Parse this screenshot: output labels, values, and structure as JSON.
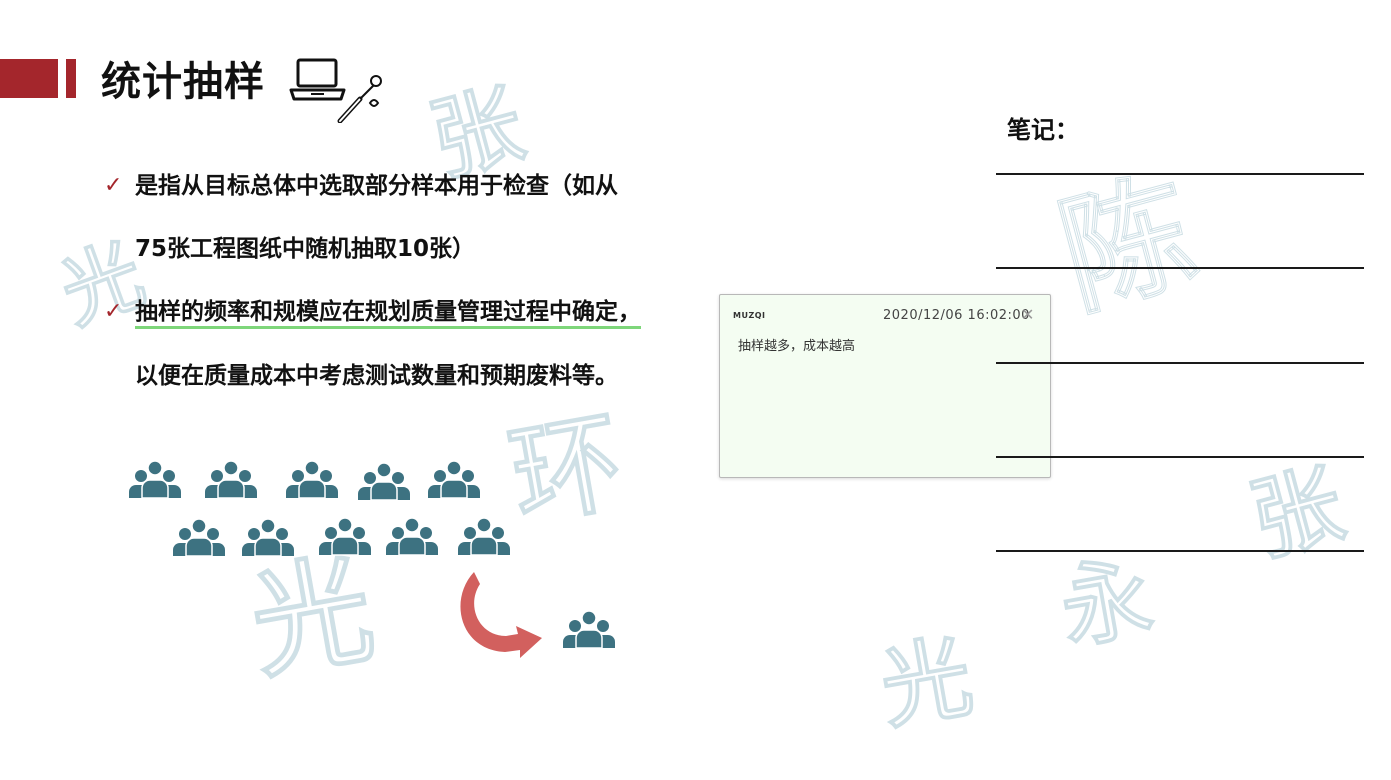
{
  "slide": {
    "title": "统计抽样",
    "bullets": [
      {
        "lines": [
          "是指从目标总体中选取部分样本用于检查（如从",
          "75张工程图纸中随机抽取10张）"
        ]
      },
      {
        "lines": [
          "抽样的频率和规模应在规划质量管理过程中确定，",
          "以便在质量成本中考虑测试数量和预期废料等。"
        ]
      }
    ],
    "check_symbol": "✓"
  },
  "notes": {
    "label": "笔记："
  },
  "sticky_note": {
    "brand": "MUZQI",
    "timestamp": "2020/12/06 16:02:00",
    "close_symbol": "✕",
    "text": "抽样越多，成本越高"
  },
  "colors": {
    "accent": "#a4262c",
    "people": "#3d7281",
    "arrow": "#d2605e",
    "underline": "#7ed67a",
    "sticky_bg": "#f4fdf2"
  },
  "icons": [
    "laptop-icon",
    "screwdriver-icon",
    "people-group-icon",
    "curved-arrow-icon"
  ]
}
